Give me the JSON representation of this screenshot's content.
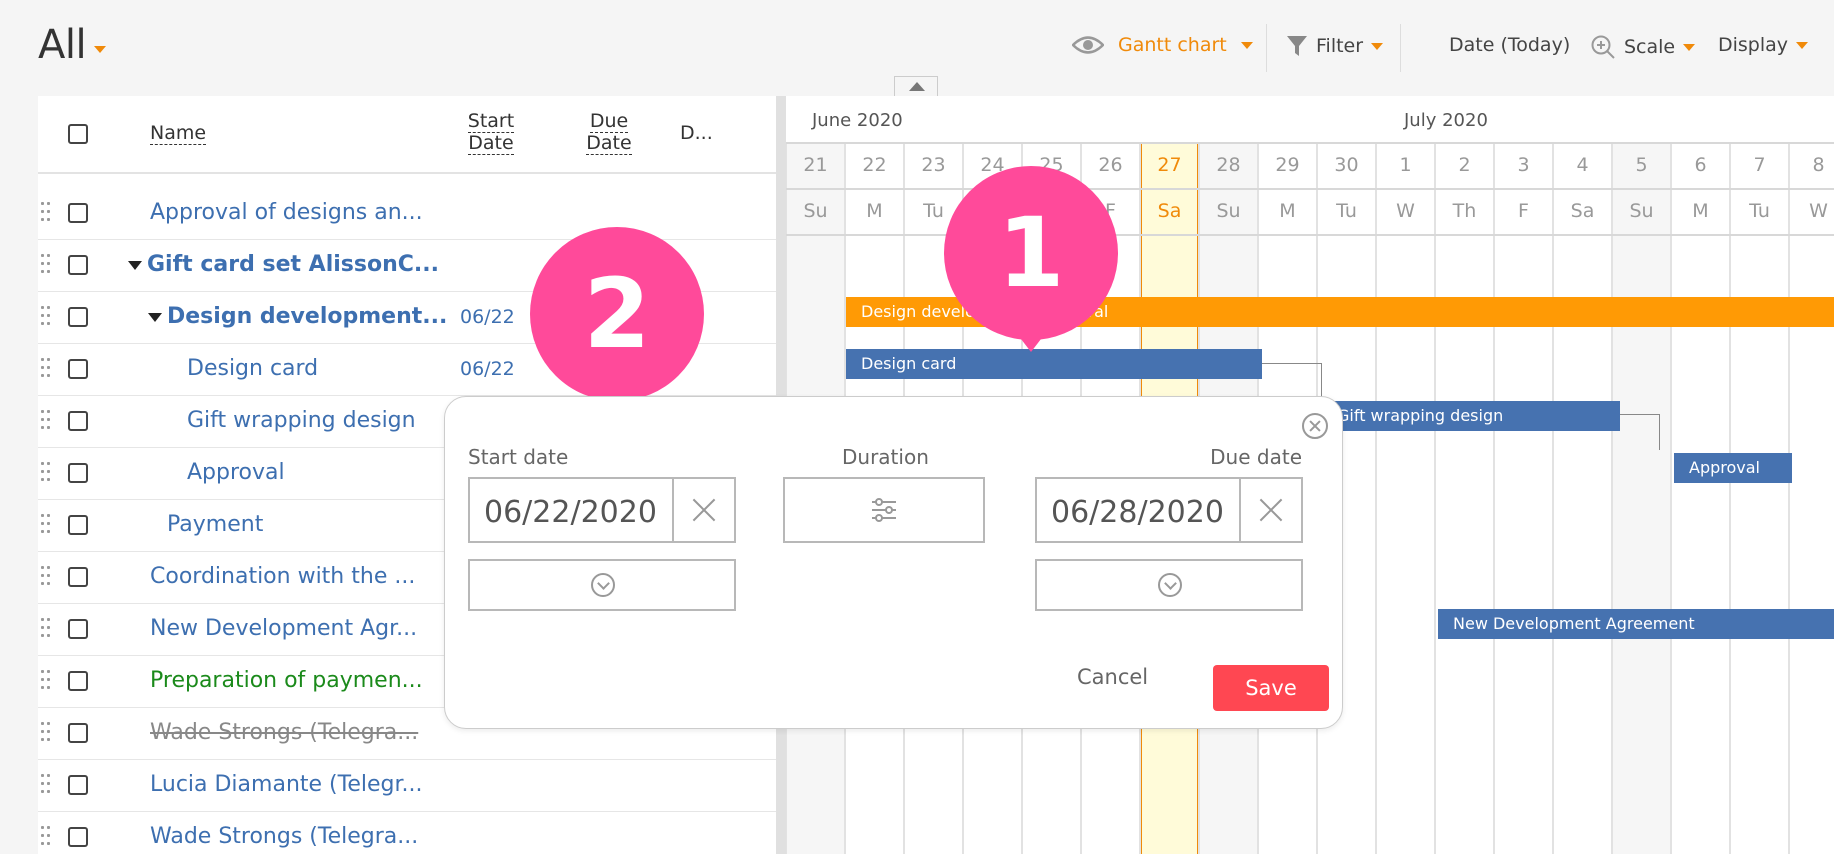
{
  "header": {
    "view_title": "All",
    "gantt_label": "Gantt chart",
    "filter_label": "Filter",
    "date_label": "Date (Today)",
    "scale_label": "Scale",
    "display_label": "Display",
    "accent_color": "#f08a0a"
  },
  "list": {
    "columns": {
      "name": "Name",
      "start": "Start Date",
      "due": "Due Date",
      "extra": "D..."
    },
    "rows": [
      {
        "name": "Approval of designs an...",
        "date": ""
      },
      {
        "name": "Gift card set AlissonC...",
        "date": ""
      },
      {
        "name": "Design development...",
        "date": "06/22"
      },
      {
        "name": "Design card",
        "date": "06/22"
      },
      {
        "name": "Gift wrapping design",
        "date": ""
      },
      {
        "name": "Approval",
        "date": ""
      },
      {
        "name": "Payment",
        "date": ""
      },
      {
        "name": "Coordination with the ...",
        "date": ""
      },
      {
        "name": "New Development Agr...",
        "date": ""
      },
      {
        "name": "Preparation of paymen...",
        "date": ""
      },
      {
        "name": "Wade Strongs (Telegra...",
        "date": ""
      },
      {
        "name": "Lucia Diamante (Telegr...",
        "date": ""
      },
      {
        "name": "Wade Strongs (Telegra...",
        "date": ""
      }
    ]
  },
  "gantt": {
    "months": [
      "June 2020",
      "July 2020"
    ],
    "days": [
      "21",
      "22",
      "23",
      "24",
      "25",
      "26",
      "27",
      "28",
      "29",
      "30",
      "1",
      "2",
      "3",
      "4",
      "5",
      "6",
      "7",
      "8"
    ],
    "weekdays": [
      "Su",
      "M",
      "Tu",
      "W",
      "Th",
      "F",
      "Sa",
      "Su",
      "M",
      "Tu",
      "W",
      "Th",
      "F",
      "Sa",
      "Su",
      "M",
      "Tu",
      "W"
    ],
    "today": "27",
    "bars": {
      "design_development": "Design development: Approval",
      "design_card": "Design card",
      "gift_wrapping": "Gift wrapping design",
      "approval": "Approval",
      "new_dev": "New Development Agreement"
    }
  },
  "markers": {
    "one": "1",
    "two": "2"
  },
  "popup": {
    "start_label": "Start date",
    "duration_label": "Duration",
    "due_label": "Due date",
    "start_value": "06/22/2020",
    "due_value": "06/28/2020",
    "cancel_label": "Cancel",
    "save_label": "Save",
    "save_color": "#ff4752"
  }
}
